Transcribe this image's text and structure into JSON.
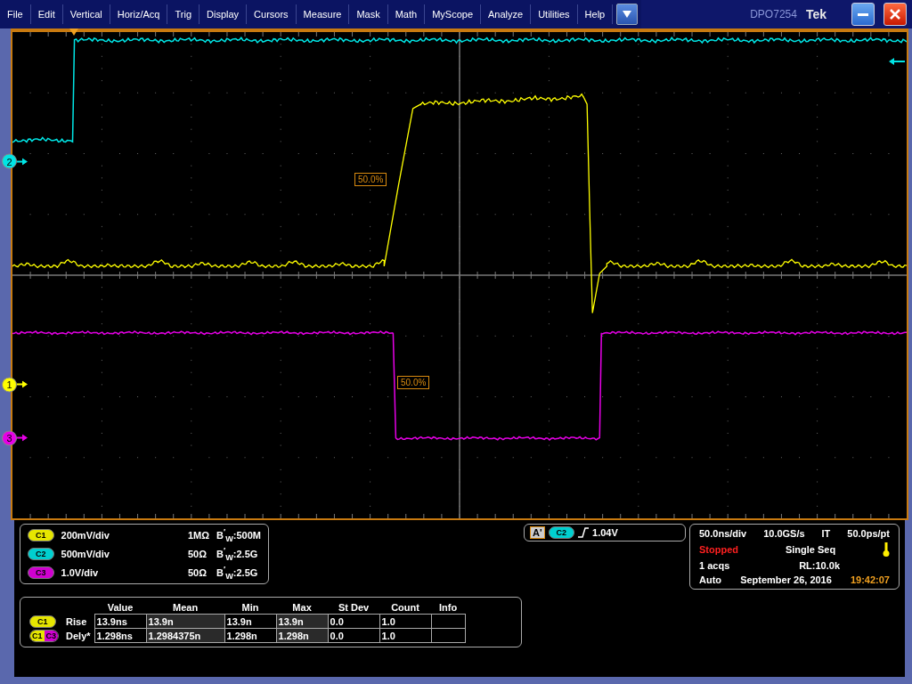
{
  "menu": [
    "File",
    "Edit",
    "Vertical",
    "Horiz/Acq",
    "Trig",
    "Display",
    "Cursors",
    "Measure",
    "Mask",
    "Math",
    "MyScope",
    "Analyze",
    "Utilities",
    "Help"
  ],
  "title_bar": {
    "model": "DPO7254",
    "brand": "Tek"
  },
  "display": {
    "channel_markers": [
      {
        "label": "2",
        "color": "#00e5e5"
      },
      {
        "label": "1",
        "color": "#ffff00"
      },
      {
        "label": "3",
        "color": "#e600e6"
      }
    ],
    "reference_labels": [
      "50.0%",
      "50.0%"
    ]
  },
  "channels": [
    {
      "badge": "C1",
      "color": "#e6e600",
      "scale": "200mV/div",
      "impedance": "1MΩ",
      "bandwidth": "B$^{′}$$_{W}$:500M"
    },
    {
      "badge": "C2",
      "color": "#00d0d0",
      "scale": "500mV/div",
      "impedance": "50Ω",
      "bandwidth": "B$^{′}$$_{W}$:2.5G"
    },
    {
      "badge": "C3",
      "color": "#d000d0",
      "scale": "1.0V/div",
      "impedance": "50Ω",
      "bandwidth": "B$^{′}$$_{W}$:2.5G"
    }
  ],
  "trigger": {
    "label": "A'",
    "badge": "C2",
    "color": "#00d0d0",
    "value": "1.04V"
  },
  "timebase": {
    "scale": "50.0ns/div",
    "sample_rate": "10.0GS/s",
    "mode": "IT",
    "resolution": "50.0ps/pt",
    "status": "Stopped",
    "acq_mode": "Single Seq",
    "acqs": "1 acqs",
    "record_length": "RL:10.0k",
    "trigger_mode": "Auto",
    "date": "September 26, 2016",
    "time": "19:42:07"
  },
  "measurements": {
    "columns": [
      "Value",
      "Mean",
      "Min",
      "Max",
      "St Dev",
      "Count",
      "Info"
    ],
    "rows": [
      {
        "badges": [
          {
            "label": "C1",
            "color": "#e6e600"
          }
        ],
        "name": "Rise",
        "cells": [
          "13.9ns",
          "13.9n",
          "13.9n",
          "13.9n",
          "0.0",
          "1.0"
        ]
      },
      {
        "badges": [
          {
            "label": "C1",
            "color": "#e6e600"
          },
          {
            "label": "C3",
            "color": "#d000d0"
          }
        ],
        "name": "Dely*",
        "cells": [
          "1.298ns",
          "1.2984375n",
          "1.298n",
          "1.298n",
          "0.0",
          "1.0"
        ]
      }
    ]
  }
}
